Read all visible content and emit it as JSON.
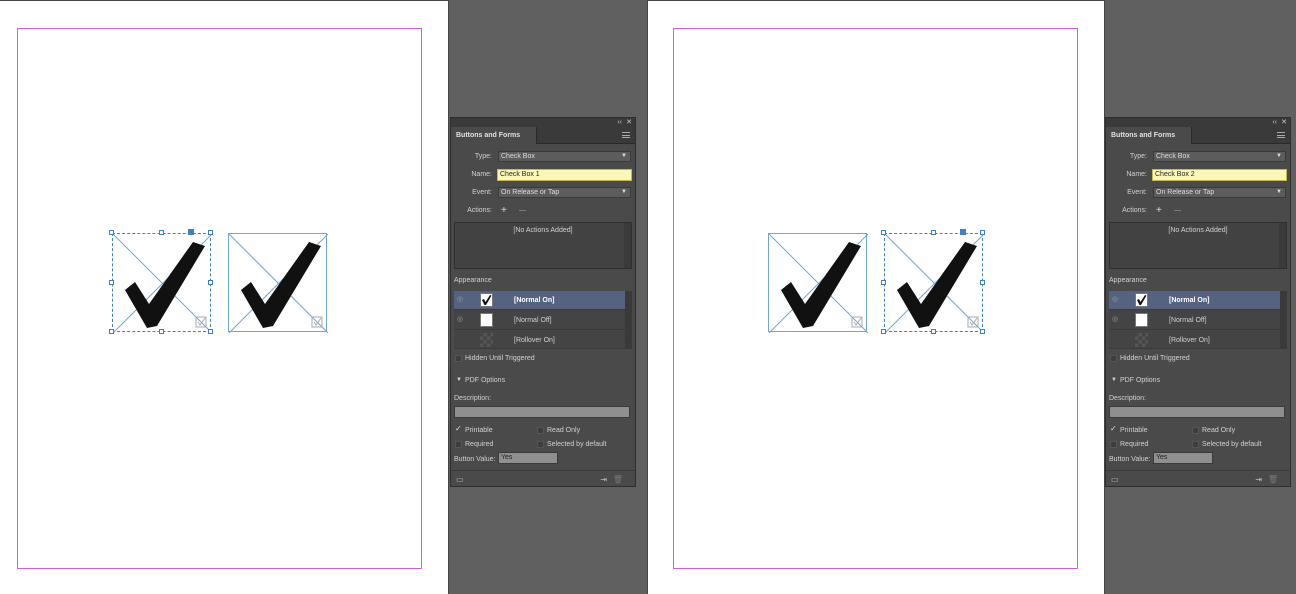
{
  "left": {
    "panel": {
      "title": "Buttons and Forms",
      "type_label": "Type:",
      "type_value": "Check Box",
      "name_label": "Name:",
      "name_value": "Check Box 1",
      "event_label": "Event:",
      "event_value": "On Release or Tap",
      "actions_label": "Actions:",
      "add_symbol": "+",
      "remove_symbol": "—",
      "no_actions": "[No Actions Added]",
      "appearance_label": "Appearance",
      "states": [
        "[Normal On]",
        "[Normal Off]",
        "[Rollover On]"
      ],
      "hidden_label": "Hidden Until Triggered",
      "pdf_options_label": "PDF Options",
      "description_label": "Description:",
      "printable_label": "Printable",
      "read_only_label": "Read Only",
      "required_label": "Required",
      "selected_default_label": "Selected by default",
      "button_value_label": "Button Value:",
      "button_value": "Yes"
    }
  },
  "right": {
    "panel": {
      "title": "Buttons and Forms",
      "type_label": "Type:",
      "type_value": "Check Box",
      "name_label": "Name:",
      "name_value": "Check Box 2",
      "event_label": "Event:",
      "event_value": "On Release or Tap",
      "actions_label": "Actions:",
      "add_symbol": "+",
      "remove_symbol": "—",
      "no_actions": "[No Actions Added]",
      "appearance_label": "Appearance",
      "states": [
        "[Normal On]",
        "[Normal Off]",
        "[Rollover On]"
      ],
      "hidden_label": "Hidden Until Triggered",
      "pdf_options_label": "PDF Options",
      "description_label": "Description:",
      "printable_label": "Printable",
      "read_only_label": "Read Only",
      "required_label": "Required",
      "selected_default_label": "Selected by default",
      "button_value_label": "Button Value:",
      "button_value": "Yes"
    }
  },
  "checkmark_glyph": "✓",
  "panel_controls": {
    "collapse": "‹‹",
    "close": "✕"
  },
  "colors": {
    "selection": "#3d7fcc",
    "margin_guide": "#d65ce6",
    "name_field_bg": "#fbf7b8",
    "panel_bg": "#4a4a4a",
    "selected_row": "#556380"
  }
}
